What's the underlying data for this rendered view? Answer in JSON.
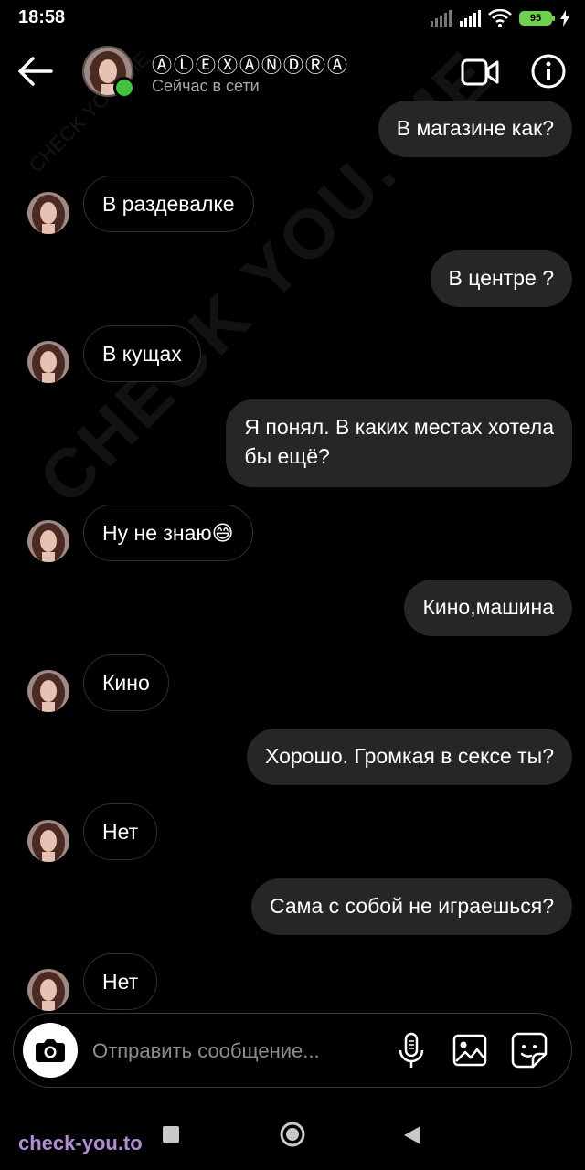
{
  "status_bar": {
    "time": "18:58",
    "battery": "95"
  },
  "header": {
    "contact_name": "ⒶⓁⒺⓍⒶⓃⒹⓇⒶ",
    "contact_status": "Сейчас в сети"
  },
  "messages": [
    {
      "direction": "out",
      "text": "В магазине как?"
    },
    {
      "direction": "in",
      "text": "В раздевалке"
    },
    {
      "direction": "out",
      "text": "В центре ?"
    },
    {
      "direction": "in",
      "text": "В кущах"
    },
    {
      "direction": "out",
      "text": "Я понял. В каких местах хотела\nбы ещё?"
    },
    {
      "direction": "in",
      "text": "Ну не знаю😅"
    },
    {
      "direction": "out",
      "text": "Кино,машина"
    },
    {
      "direction": "in",
      "text": "Кино"
    },
    {
      "direction": "out",
      "text": "Хорошо. Громкая в сексе ты?"
    },
    {
      "direction": "in",
      "text": "Нет"
    },
    {
      "direction": "out",
      "text": "Сама с собой не играешься?"
    },
    {
      "direction": "in",
      "text": "Нет"
    }
  ],
  "composer": {
    "placeholder": "Отправить сообщение..."
  },
  "watermark": {
    "text": "CHECK YOU. ME",
    "site_label": "check-you.to"
  },
  "colors": {
    "outgoing_bubble": "#262626",
    "online": "#3ec43e",
    "battery": "#6fd14b",
    "site_label": "#b28cd6"
  },
  "icons": {
    "back": "arrow-left-icon",
    "video": "video-camera-icon",
    "info": "info-icon",
    "camera": "camera-icon",
    "mic": "microphone-icon",
    "gallery": "image-icon",
    "sticker": "sticker-icon"
  }
}
